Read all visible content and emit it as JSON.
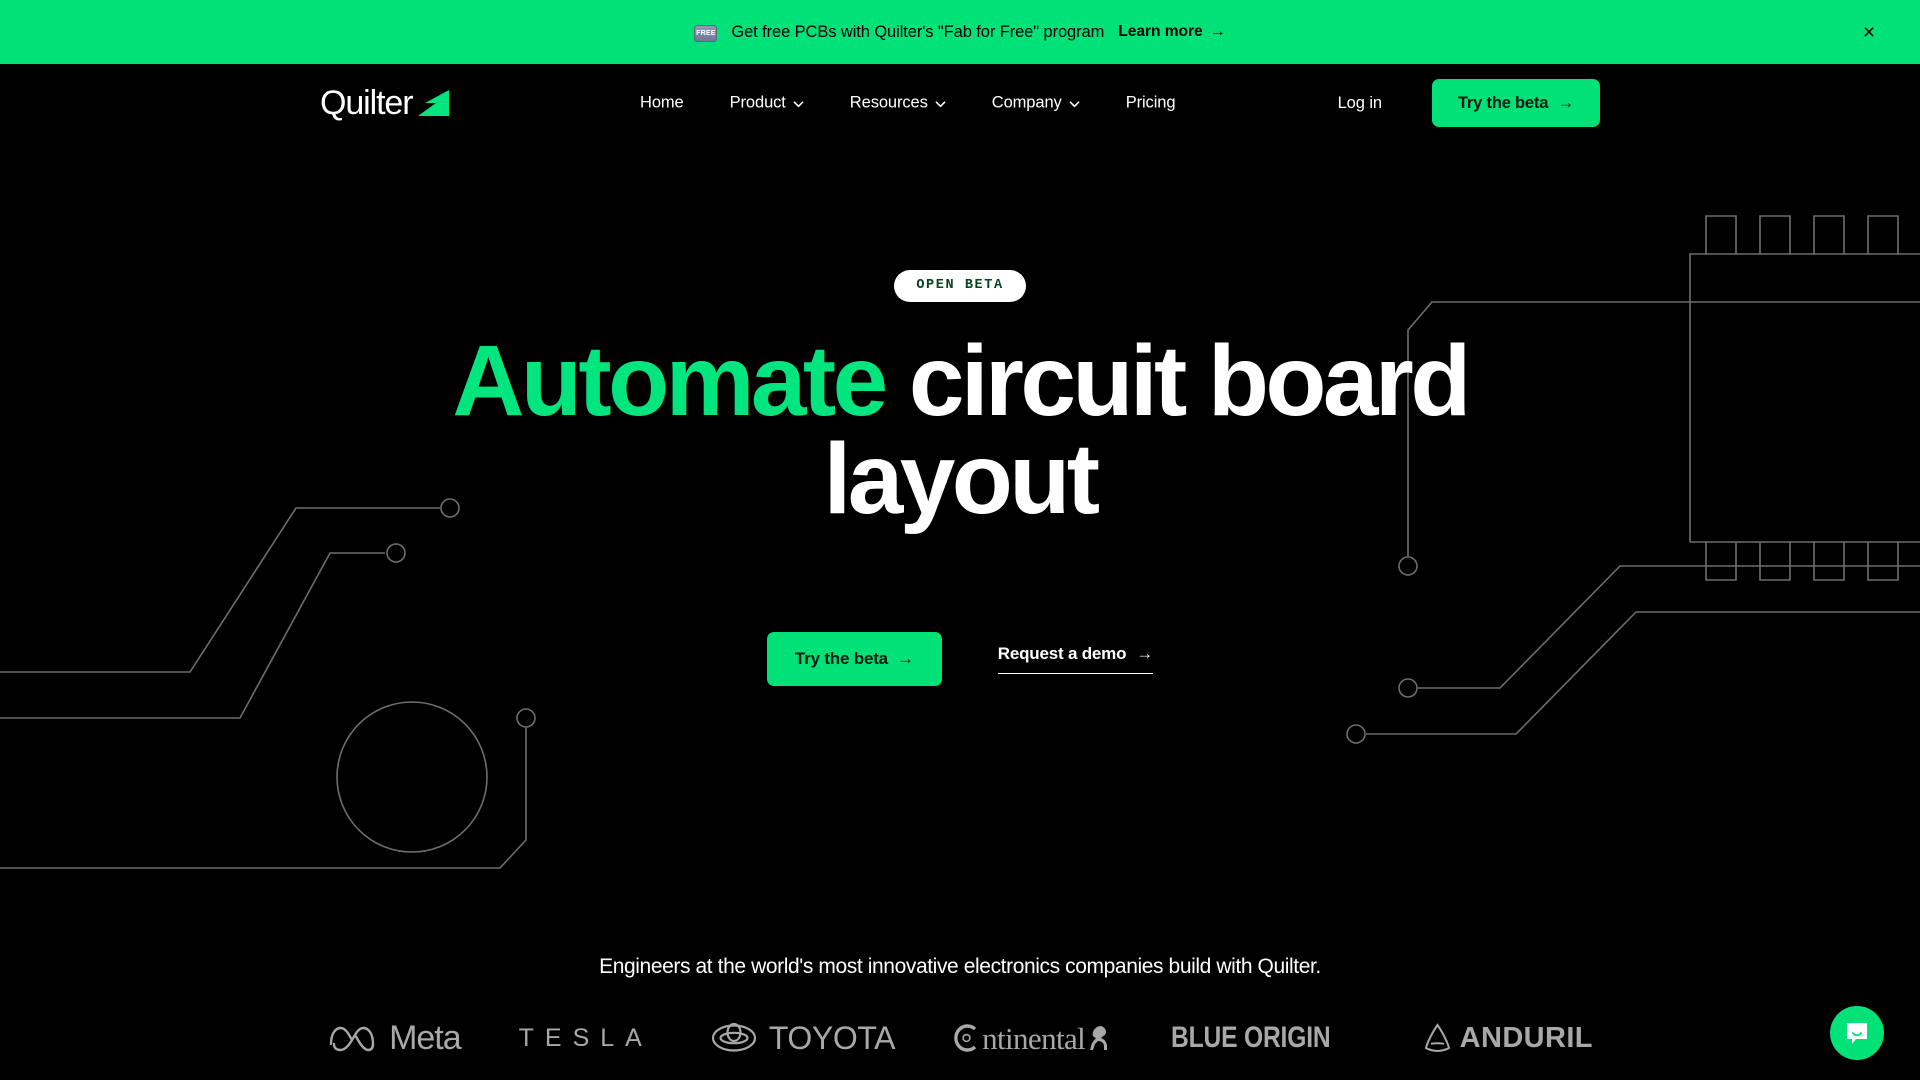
{
  "banner": {
    "badge_label": "FREE",
    "text": "Get free PCBs with Quilter's \"Fab for Free\" program",
    "link_label": "Learn more",
    "link_arrow": "→",
    "close_label": "×",
    "background_color": "#00E178",
    "text_color": "#000000"
  },
  "header": {
    "logo_text": "Quilter",
    "nav": [
      {
        "label": "Home",
        "has_dropdown": false
      },
      {
        "label": "Product",
        "has_dropdown": true
      },
      {
        "label": "Resources",
        "has_dropdown": true
      },
      {
        "label": "Company",
        "has_dropdown": true
      },
      {
        "label": "Pricing",
        "has_dropdown": false
      }
    ],
    "login_label": "Log in",
    "cta_label": "Try the beta",
    "cta_arrow": "→"
  },
  "hero": {
    "badge": "OPEN BETA",
    "headline_accent": "Automate",
    "headline_rest": " circuit board layout",
    "primary_cta": "Try the beta",
    "primary_cta_arrow": "→",
    "secondary_cta": "Request a demo",
    "secondary_cta_arrow": "→",
    "accent_color": "#00E57D"
  },
  "social_proof": {
    "tagline": "Engineers at the world's most innovative electronics companies build with Quilter.",
    "brands": [
      {
        "name": "Meta",
        "label": "Meta"
      },
      {
        "name": "Tesla",
        "label": "TESLA"
      },
      {
        "name": "Toyota",
        "label": "TOYOTA"
      },
      {
        "name": "Continental",
        "label": "ntinental"
      },
      {
        "name": "Blue Origin",
        "label": "BLUE ORIGIN"
      },
      {
        "name": "Anduril",
        "label": "ANDURIL"
      }
    ]
  },
  "chat": {
    "label": "chat-bubble-icon"
  }
}
